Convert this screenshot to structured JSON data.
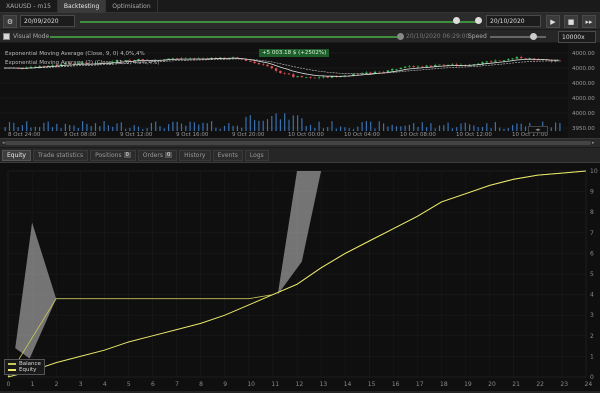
{
  "top_tabs": [
    {
      "label": "XAUUSD - m15"
    },
    {
      "label": "Backtesting"
    },
    {
      "label": "Optimisation"
    }
  ],
  "toolbar": {
    "start_date": "20/09/2020",
    "end_date": "20/10/2020",
    "timeline_progress": 1.0,
    "speed_value": "10000x"
  },
  "visual": {
    "mode_label": "Visual Mode",
    "mode_checked": true,
    "timestamp": "20/10/2020 06:29:00",
    "speed_label": "Speed"
  },
  "price_chart": {
    "indicator_1": "Exponential Moving Average (Close, 9, 0) 4,0%,4%",
    "indicator_2": "Exponential Moving Average (2) (Close, 21, 0, 4.0%,4%)",
    "profit_badge": "+5 003.18 $ (+2502%)",
    "price_labels": [
      "4000.00",
      "4000.00",
      "4000.00",
      "4000.00",
      "4000.00",
      "3950.00"
    ],
    "time_labels": [
      "8 Oct 24:00",
      "9 Oct 08:00",
      "9 Oct 12:00",
      "9 Oct 16:00",
      "9 Oct 20:00",
      "10 Oct 00:00",
      "10 Oct 04:00",
      "10 Oct 08:00",
      "10 Oct 12:00",
      "10 Oct 17:00"
    ]
  },
  "bottom_tabs": [
    {
      "label": "Equity"
    },
    {
      "label": "Trade statistics"
    },
    {
      "label": "Positions",
      "count": "0"
    },
    {
      "label": "Orders",
      "count": "0"
    },
    {
      "label": "History"
    },
    {
      "label": "Events"
    },
    {
      "label": "Logs"
    }
  ],
  "equity_chart": {
    "legend": [
      "Balance",
      "Equity"
    ],
    "colors": {
      "equity": "#e8e86a",
      "balance": "#c7c75a",
      "band": "#c8c8c8"
    }
  },
  "chart_data": {
    "type": "line",
    "x": [
      0,
      1,
      2,
      3,
      4,
      5,
      6,
      7,
      8,
      9,
      10,
      11,
      12,
      13,
      14,
      15,
      16,
      17,
      18,
      19,
      20,
      21,
      22,
      23,
      24
    ],
    "x_ticks": [
      "0",
      "1",
      "2",
      "3",
      "4",
      "5",
      "6",
      "7",
      "8",
      "9",
      "10",
      "11",
      "12",
      "13",
      "14",
      "15",
      "16",
      "17",
      "18",
      "19",
      "20",
      "21",
      "22",
      "23",
      "24"
    ],
    "y_ticks": [
      "0",
      "1",
      "2",
      "3",
      "4",
      "5",
      "6",
      "7",
      "8",
      "9",
      "10"
    ],
    "xlim": [
      0,
      24
    ],
    "ylim": [
      0,
      10
    ],
    "series": [
      {
        "name": "Equity",
        "values": [
          0.0,
          0.3,
          0.7,
          1.0,
          1.3,
          1.7,
          2.0,
          2.3,
          2.6,
          3.0,
          3.5,
          4.0,
          4.5,
          5.3,
          6.0,
          6.6,
          7.2,
          7.8,
          8.5,
          8.9,
          9.3,
          9.6,
          9.8,
          9.9,
          10.0
        ]
      },
      {
        "name": "Balance",
        "values": [
          0.0,
          null,
          3.8,
          3.8,
          3.8,
          3.8,
          3.8,
          3.8,
          3.8,
          3.8,
          3.8,
          4.0,
          4.5,
          5.3,
          6.0,
          6.6,
          7.2,
          7.8,
          8.5,
          8.9,
          9.3,
          9.6,
          9.8,
          9.9,
          10.0
        ]
      }
    ],
    "grid": true,
    "legend_position": "bottom-left"
  }
}
